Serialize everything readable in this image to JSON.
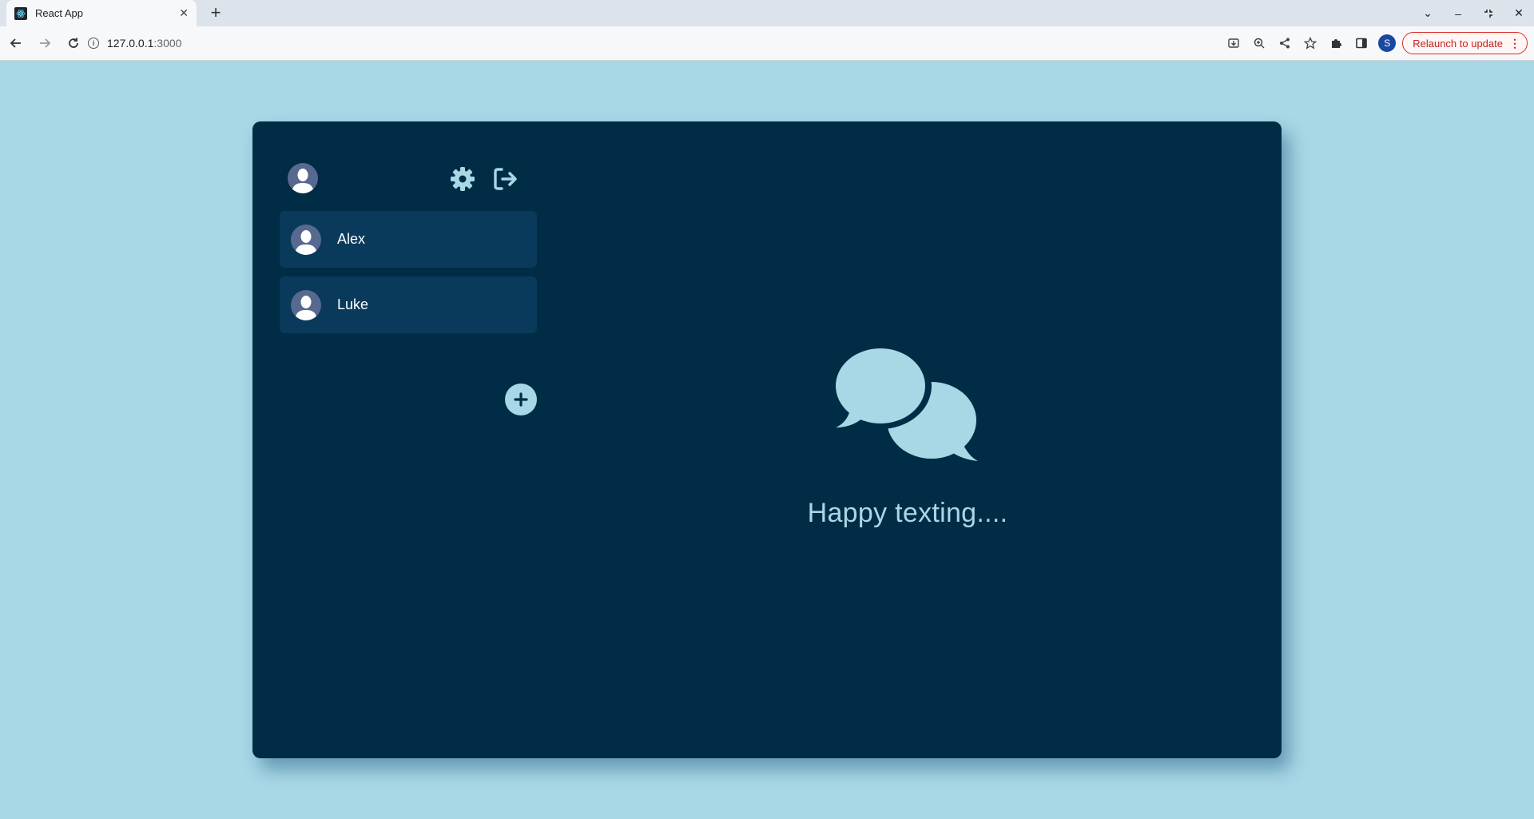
{
  "browser": {
    "tab_title": "React App",
    "url_host": "127.0.0.1",
    "url_port": ":3000",
    "profile_initial": "S",
    "relaunch_label": "Relaunch to update"
  },
  "app": {
    "contacts": [
      {
        "name": "Alex"
      },
      {
        "name": "Luke"
      }
    ],
    "welcome_text": "Happy texting....",
    "colors": {
      "page_bg": "#a8d7e6",
      "card_bg": "#002c46",
      "contact_bg": "#0a3a5b",
      "accent": "#a8d7e6",
      "avatar_bg": "#586990"
    },
    "icons": [
      "user-avatar-icon",
      "gear-icon",
      "logout-icon",
      "plus-icon",
      "chat-bubbles-icon"
    ]
  }
}
